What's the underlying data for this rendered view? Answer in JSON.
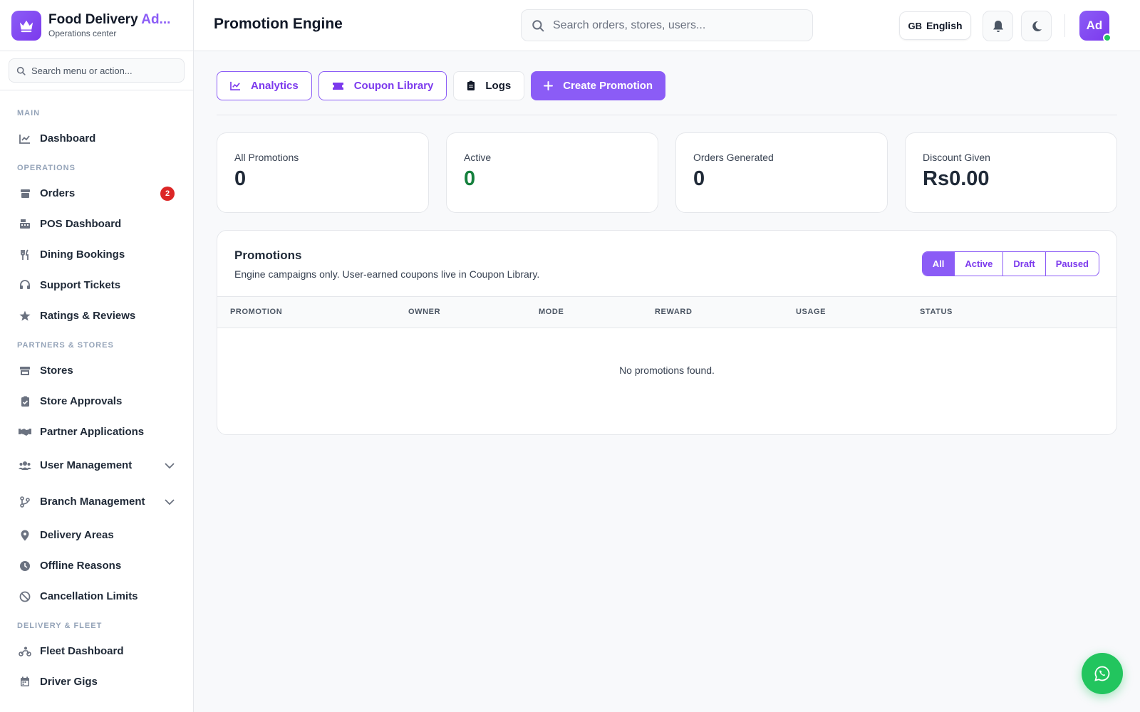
{
  "brand": {
    "title_prefix": "Food Delivery ",
    "title_accent": "Ad...",
    "subtitle": "Operations center",
    "icon": "crown-icon"
  },
  "sidebar": {
    "search_placeholder": "Search menu or action...",
    "sections": [
      {
        "label": "MAIN",
        "items": [
          {
            "label": "Dashboard",
            "icon": "chart-line-icon"
          }
        ]
      },
      {
        "label": "OPERATIONS",
        "items": [
          {
            "label": "Orders",
            "icon": "box-icon",
            "badge": "2"
          },
          {
            "label": "POS Dashboard",
            "icon": "cash-register-icon"
          },
          {
            "label": "Dining Bookings",
            "icon": "utensils-icon"
          },
          {
            "label": "Support Tickets",
            "icon": "headset-icon"
          },
          {
            "label": "Ratings & Reviews",
            "icon": "star-icon"
          }
        ]
      },
      {
        "label": "PARTNERS & STORES",
        "items": [
          {
            "label": "Stores",
            "icon": "store-icon"
          },
          {
            "label": "Store Approvals",
            "icon": "clipboard-check-icon"
          },
          {
            "label": "Partner Applications",
            "icon": "handshake-icon"
          },
          {
            "label": "User Management",
            "icon": "users-icon",
            "expandable": true
          },
          {
            "label": "Branch Management",
            "icon": "branch-icon",
            "expandable": true
          },
          {
            "label": "Delivery Areas",
            "icon": "map-pin-icon"
          },
          {
            "label": "Offline Reasons",
            "icon": "clock-icon"
          },
          {
            "label": "Cancellation Limits",
            "icon": "ban-icon"
          }
        ]
      },
      {
        "label": "DELIVERY & FLEET",
        "items": [
          {
            "label": "Fleet Dashboard",
            "icon": "motorcycle-icon"
          },
          {
            "label": "Driver Gigs",
            "icon": "calendar-icon"
          }
        ]
      }
    ]
  },
  "header": {
    "title": "Promotion Engine",
    "search_placeholder": "Search orders, stores, users...",
    "language_code": "GB",
    "language_label": "English",
    "avatar_initials": "Ad"
  },
  "toolbar": {
    "analytics": "Analytics",
    "coupon_library": "Coupon Library",
    "logs": "Logs",
    "create": "Create Promotion"
  },
  "stats": [
    {
      "label": "All Promotions",
      "value": "0"
    },
    {
      "label": "Active",
      "value": "0",
      "color": "#15803d"
    },
    {
      "label": "Orders Generated",
      "value": "0"
    },
    {
      "label": "Discount Given",
      "value": "Rs0.00"
    }
  ],
  "promotions": {
    "title": "Promotions",
    "subtitle": "Engine campaigns only. User-earned coupons live in Coupon Library.",
    "filters": [
      "All",
      "Active",
      "Draft",
      "Paused"
    ],
    "active_filter": "All",
    "columns": [
      "PROMOTION",
      "OWNER",
      "MODE",
      "REWARD",
      "USAGE",
      "STATUS"
    ],
    "empty_text": "No promotions found."
  },
  "colors": {
    "accent": "#8b5cf6",
    "success": "#22c55e",
    "danger": "#dc2626"
  }
}
